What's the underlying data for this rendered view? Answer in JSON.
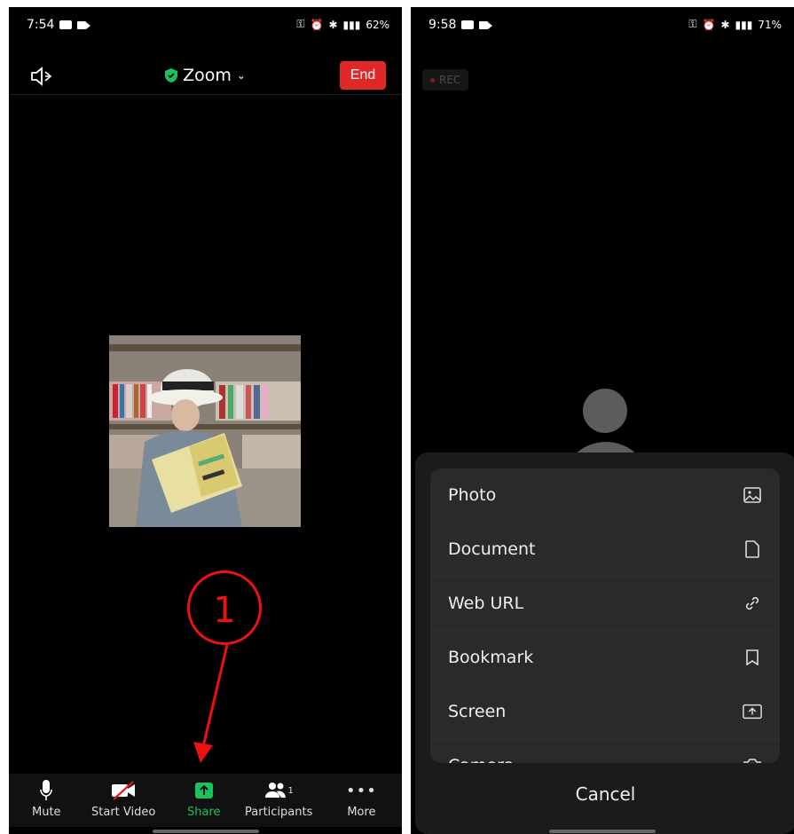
{
  "left": {
    "status": {
      "time": "7:54",
      "battery": "62%"
    },
    "title": "Zoom",
    "end_label": "End",
    "annotation_number": "1",
    "toolbar": [
      {
        "label": "Mute",
        "icon": "mic-icon"
      },
      {
        "label": "Start Video",
        "icon": "video-off-icon"
      },
      {
        "label": "Share",
        "icon": "share-icon"
      },
      {
        "label": "Participants",
        "icon": "participants-icon",
        "badge": "1"
      },
      {
        "label": "More",
        "icon": "more-icon"
      }
    ]
  },
  "right": {
    "status": {
      "time": "9:58",
      "battery": "71%"
    },
    "rec_label": "REC",
    "share_menu": [
      {
        "label": "Photo",
        "icon": "image-icon"
      },
      {
        "label": "Document",
        "icon": "document-icon"
      },
      {
        "label": "Web URL",
        "icon": "link-icon"
      },
      {
        "label": "Bookmark",
        "icon": "bookmark-icon"
      },
      {
        "label": "Screen",
        "icon": "screen-share-icon"
      },
      {
        "label": "Camera",
        "icon": "camera-icon"
      }
    ],
    "cancel_label": "Cancel"
  },
  "colors": {
    "accent_green": "#19c25b",
    "end_red": "#e02828",
    "annotation_red": "#e11111"
  }
}
